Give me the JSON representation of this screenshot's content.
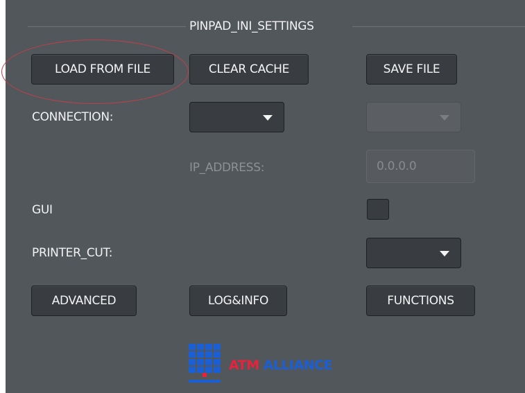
{
  "group": {
    "title": "PINPAD_INI_SETTINGS"
  },
  "buttons": {
    "load_from_file": "LOAD FROM FILE",
    "clear_cache": "CLEAR CACHE",
    "save_file": "SAVE FILE",
    "advanced": "ADVANCED",
    "log_info": "LOG&INFO",
    "functions": "FUNCTIONS"
  },
  "fields": {
    "connection_label": "CONNECTION:",
    "connection_value": "",
    "connection_secondary_value": "",
    "ip_address_label": "IP_ADDRESS:",
    "ip_address_value": "0.0.0.0",
    "gui_label": "GUI",
    "gui_checked": false,
    "printer_cut_label": "PRINTER_CUT:",
    "printer_cut_value": ""
  },
  "logo": {
    "word1": "ATM",
    "word2": "ALLIANCE",
    "color_red": "#e8223a",
    "color_blue": "#1a5fd6"
  },
  "annotation": {
    "shape": "ellipse",
    "color": "#c0404a",
    "target": "load-from-file-button"
  },
  "colors": {
    "panel_bg": "#52575c",
    "button_bg": "#393d42",
    "text": "#f2f2f2",
    "disabled_text": "#8d9196"
  }
}
